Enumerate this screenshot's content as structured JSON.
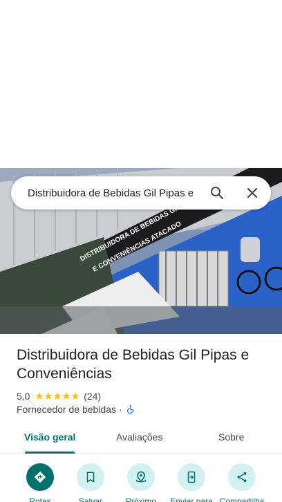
{
  "search": {
    "query": "Distribuidora de Bebidas Gil Pipas e"
  },
  "photo": {
    "sign_text_top": "DISTRIBUIDORA DE BEBIDAS GIL PIPAS",
    "sign_text_bottom": "E CONVENIÊNCIAS ATACADO"
  },
  "place": {
    "name": "Distribuidora de Bebidas Gil Pipas e Conveniências",
    "rating": "5,0",
    "stars": "★★★★★",
    "review_count": "(24)",
    "category": "Fornecedor de bebidas",
    "bullet": "·"
  },
  "tabs": [
    {
      "label": "Visão geral",
      "active": true
    },
    {
      "label": "Avaliações",
      "active": false
    },
    {
      "label": "Sobre",
      "active": false
    }
  ],
  "actions": [
    {
      "label": "Rotas",
      "icon": "directions-icon"
    },
    {
      "label": "Salvar",
      "icon": "bookmark-icon"
    },
    {
      "label": "Próximo",
      "icon": "nearby-icon"
    },
    {
      "label": "Enviar para",
      "icon": "send-to-phone-icon"
    },
    {
      "label": "Compartilha",
      "icon": "share-icon"
    }
  ],
  "colors": {
    "accent": "#00706b",
    "action_bg": "#d3f1f3",
    "star": "#fbbc04"
  }
}
